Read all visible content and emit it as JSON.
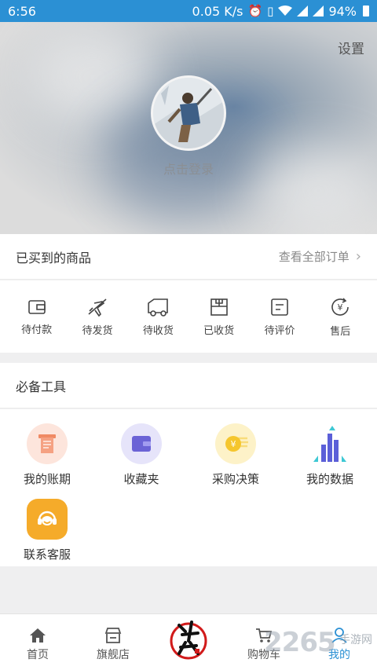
{
  "status": {
    "time": "6:56",
    "speed": "0.05 K/s",
    "battery": "94%"
  },
  "hero": {
    "settings_label": "设置",
    "login_label": "点击登录"
  },
  "orders": {
    "title": "已买到的商品",
    "view_all": "查看全部订单",
    "items": [
      {
        "label": "待付款",
        "icon": "wallet-icon"
      },
      {
        "label": "待发货",
        "icon": "airplane-icon"
      },
      {
        "label": "待收货",
        "icon": "truck-icon"
      },
      {
        "label": "已收货",
        "icon": "package-icon"
      },
      {
        "label": "待评价",
        "icon": "comment-icon"
      },
      {
        "label": "售后",
        "icon": "yen-refresh-icon"
      }
    ]
  },
  "tools": {
    "title": "必备工具",
    "items": [
      {
        "label": "我的账期",
        "icon": "bill-icon",
        "color": "#f5a182"
      },
      {
        "label": "收藏夹",
        "icon": "wallet-folder-icon",
        "color": "#6b63d6"
      },
      {
        "label": "采购决策",
        "icon": "coin-icon",
        "color": "#f5c62d"
      },
      {
        "label": "我的数据",
        "icon": "bar-chart-icon",
        "color": "#5b5fd8"
      },
      {
        "label": "联系客服",
        "icon": "headset-icon",
        "color": "#f5ab2a"
      }
    ]
  },
  "tabbar": {
    "tabs": [
      {
        "label": "首页",
        "icon": "home-icon"
      },
      {
        "label": "旗舰店",
        "icon": "store-icon"
      },
      {
        "label": "",
        "icon": "brand-logo"
      },
      {
        "label": "购物车",
        "icon": "cart-icon"
      },
      {
        "label": "我的",
        "icon": "user-icon",
        "active": true
      }
    ]
  },
  "watermark": {
    "number": "2265",
    "site": "手游网"
  },
  "colors": {
    "accent": "#2b90d4",
    "background": "#efeff0"
  }
}
